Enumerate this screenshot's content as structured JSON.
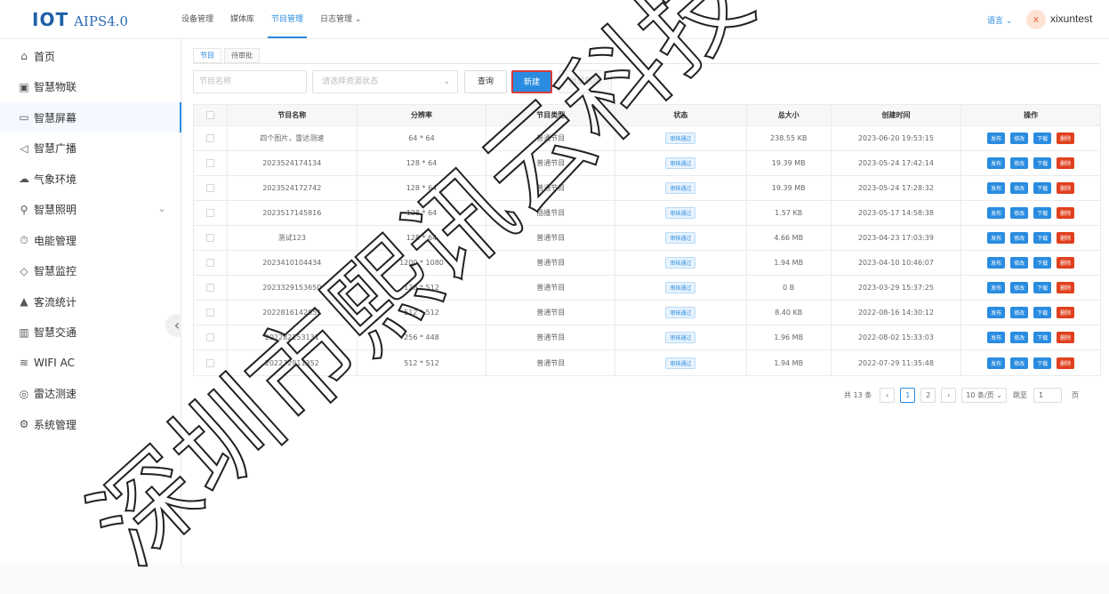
{
  "brand": {
    "logo": "IOT",
    "product": "AIPS4.0"
  },
  "topnav": {
    "items": [
      "设备管理",
      "媒体库",
      "节目管理",
      "日志管理 ⌄"
    ],
    "active_index": 2
  },
  "header": {
    "language": "语言 ⌄",
    "avatar": "x",
    "username": "xixuntest"
  },
  "sidebar": {
    "items": [
      {
        "label": "首页",
        "icon": "home-icon",
        "glyph": "⌂"
      },
      {
        "label": "智慧物联",
        "icon": "iot-icon",
        "glyph": "▣"
      },
      {
        "label": "智慧屏幕",
        "icon": "screen-icon",
        "glyph": "▭"
      },
      {
        "label": "智慧广播",
        "icon": "speaker-icon",
        "glyph": "◁"
      },
      {
        "label": "气象环境",
        "icon": "weather-icon",
        "glyph": "☁"
      },
      {
        "label": "智慧照明",
        "icon": "light-icon",
        "glyph": "⚲"
      },
      {
        "label": "电能管理",
        "icon": "power-icon",
        "glyph": "⏱"
      },
      {
        "label": "智慧监控",
        "icon": "monitor-icon",
        "glyph": "◇"
      },
      {
        "label": "客流统计",
        "icon": "stats-icon",
        "glyph": "▲"
      },
      {
        "label": "智慧交通",
        "icon": "traffic-icon",
        "glyph": "▥"
      },
      {
        "label": "WIFI AC",
        "icon": "wifi-icon",
        "glyph": "≋"
      },
      {
        "label": "雷达测速",
        "icon": "radar-icon",
        "glyph": "◎"
      },
      {
        "label": "系统管理",
        "icon": "settings-icon",
        "glyph": "⚙"
      }
    ],
    "active_index": 2,
    "collapse_glyph": "‹"
  },
  "tabs": [
    "节目",
    "待审批"
  ],
  "filters": {
    "name_placeholder": "节目名称",
    "status_placeholder": "请选择资源状态",
    "query": "查询",
    "new": "新建",
    "batch_delete": "批量删除"
  },
  "table": {
    "headers": [
      "节目名称",
      "分辨率",
      "节目类型",
      "状态",
      "总大小",
      "创建时间",
      "操作"
    ],
    "actions": [
      "发布",
      "修改",
      "下载",
      "删除"
    ],
    "rows": [
      [
        "四个图片，雷达测速",
        "64 * 64",
        "普通节目",
        "审核通过",
        "238.55 KB",
        "2023-06-20 19:53:15"
      ],
      [
        "2023524174134",
        "128 * 64",
        "普通节目",
        "审核通过",
        "19.39 MB",
        "2023-05-24 17:42:14"
      ],
      [
        "2023524172742",
        "128 * 64",
        "普通节目",
        "审核通过",
        "19.39 MB",
        "2023-05-24 17:28:32"
      ],
      [
        "2023517145816",
        "128 * 64",
        "插播节目",
        "审核通过",
        "1.57 KB",
        "2023-05-17 14:58:38"
      ],
      [
        "测试123",
        "128 * 64",
        "普通节目",
        "审核通过",
        "4.66 MB",
        "2023-04-23 17:03:39"
      ],
      [
        "2023410104434",
        "1200 * 1080",
        "普通节目",
        "审核通过",
        "1.94 MB",
        "2023-04-10 10:46:07"
      ],
      [
        "2023329153650",
        "128 * 512",
        "普通节目",
        "审核通过",
        "0 B",
        "2023-03-29 15:37:25"
      ],
      [
        "2022816142951",
        "512 * 512",
        "普通节目",
        "审核通过",
        "8.40 KB",
        "2022-08-16 14:30:12"
      ],
      [
        "202282153131",
        "256 * 448",
        "普通节目",
        "审核通过",
        "1.96 MB",
        "2022-08-02 15:33:03"
      ],
      [
        "202272911352",
        "512 * 512",
        "普通节目",
        "审核通过",
        "1.94 MB",
        "2022-07-29 11:35:48"
      ]
    ]
  },
  "pagination": {
    "total": "共 13 条",
    "prev": "‹",
    "pages": [
      "1",
      "2"
    ],
    "current": "1",
    "next": "›",
    "page_size": "10 条/页 ⌄",
    "goto_label": "跳至",
    "goto_value": "1",
    "page_suffix": "页"
  },
  "watermark": "深圳市熙讯云科技"
}
